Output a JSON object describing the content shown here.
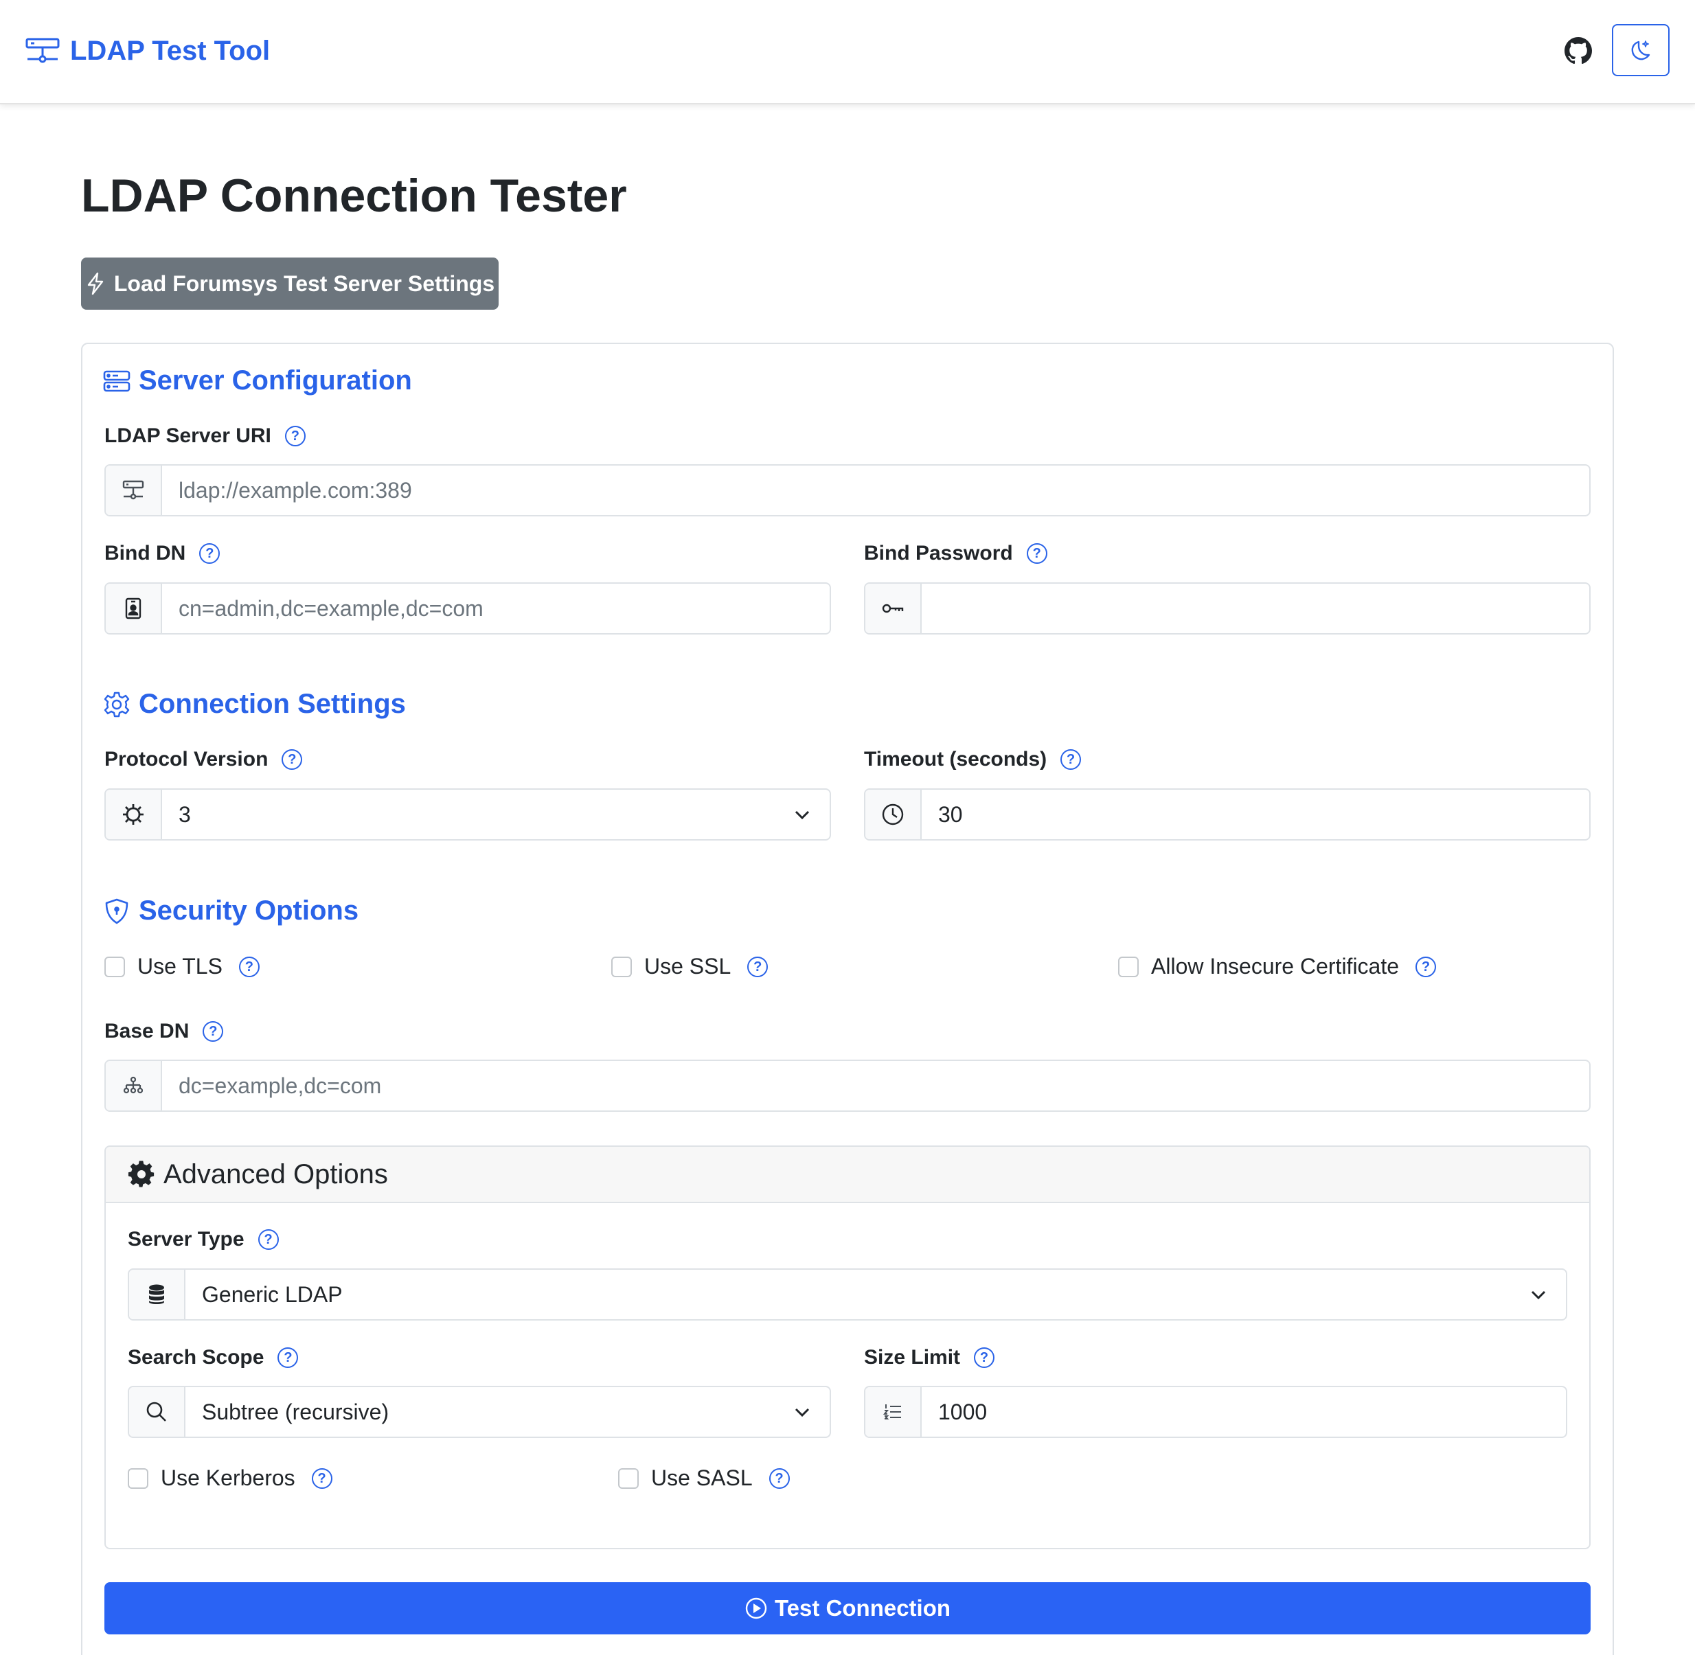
{
  "navbar": {
    "brand": "LDAP Test Tool",
    "github_icon": "github-icon",
    "theme_icon": "moon-stars-icon"
  },
  "page": {
    "title": "LDAP Connection Tester",
    "load_button": "Load Forumsys Test Server Settings"
  },
  "server_config": {
    "title": "Server Configuration",
    "uri_label": "LDAP Server URI",
    "uri_placeholder": "ldap://example.com:389",
    "bind_dn_label": "Bind DN",
    "bind_dn_placeholder": "cn=admin,dc=example,dc=com",
    "bind_password_label": "Bind Password",
    "bind_password_value": ""
  },
  "connection_settings": {
    "title": "Connection Settings",
    "protocol_label": "Protocol Version",
    "protocol_value": "3",
    "timeout_label": "Timeout (seconds)",
    "timeout_value": "30"
  },
  "security_options": {
    "title": "Security Options",
    "use_tls": "Use TLS",
    "use_ssl": "Use SSL",
    "allow_insecure": "Allow Insecure Certificate",
    "base_dn_label": "Base DN",
    "base_dn_placeholder": "dc=example,dc=com"
  },
  "advanced_options": {
    "title": "Advanced Options",
    "server_type_label": "Server Type",
    "server_type_value": "Generic LDAP",
    "search_scope_label": "Search Scope",
    "search_scope_value": "Subtree (recursive)",
    "size_limit_label": "Size Limit",
    "size_limit_value": "1000",
    "use_kerberos": "Use Kerberos",
    "use_sasl": "Use SASL"
  },
  "actions": {
    "test_button": "Test Connection"
  },
  "help_glyph": "?",
  "colors": {
    "primary": "#2a63e8",
    "secondary_button": "#6c757d",
    "test_button": "#2a63f4",
    "border": "#dee2e6"
  }
}
